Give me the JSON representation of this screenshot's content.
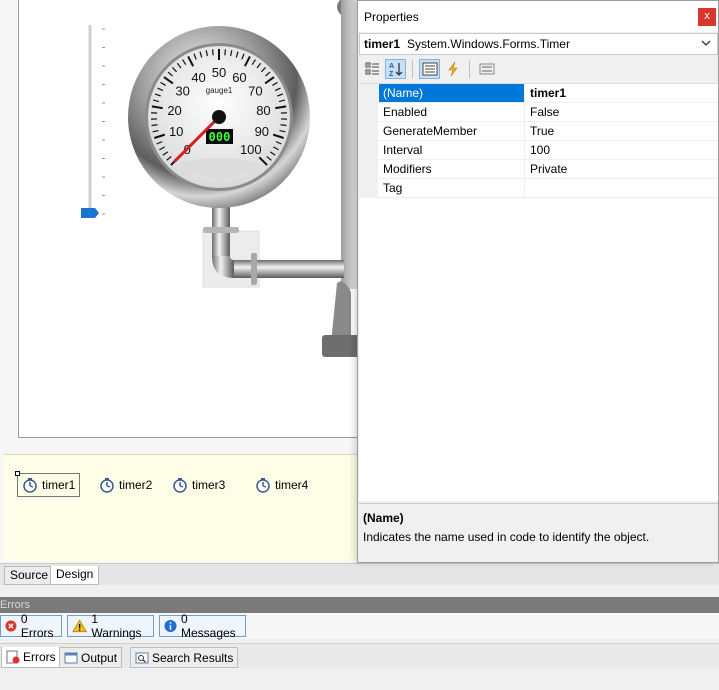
{
  "gauge": {
    "name_label": "gauge1",
    "scale_labels": [
      "0",
      "10",
      "20",
      "30",
      "40",
      "50",
      "60",
      "70",
      "80",
      "90",
      "100"
    ],
    "digital_readout": "000",
    "needle_value": 0
  },
  "slider": {
    "value_fraction": 0.0
  },
  "tray": {
    "items": [
      {
        "label": "timer1"
      },
      {
        "label": "timer2"
      },
      {
        "label": "timer3"
      },
      {
        "label": "timer4"
      }
    ]
  },
  "view_tabs": {
    "source": "Source",
    "design": "Design"
  },
  "errors_panel": {
    "header": "Errors",
    "errors_btn": "0 Errors",
    "warnings_btn": "1 Warnings",
    "messages_btn": "0 Messages"
  },
  "bottom_tabs": {
    "errors": "Errors",
    "output": "Output",
    "search": "Search Results"
  },
  "properties": {
    "title": "Properties",
    "close_label": "x",
    "object_name": "timer1",
    "object_type": "System.Windows.Forms.Timer",
    "rows": [
      {
        "name": "(Name)",
        "value": "timer1"
      },
      {
        "name": "Enabled",
        "value": "False"
      },
      {
        "name": "GenerateMember",
        "value": "True"
      },
      {
        "name": "Interval",
        "value": "100"
      },
      {
        "name": "Modifiers",
        "value": "Private"
      },
      {
        "name": "Tag",
        "value": ""
      }
    ],
    "description_title": "(Name)",
    "description_text": "Indicates the name used in code to identify the object."
  },
  "colors": {
    "accent": "#0078d7",
    "close_red": "#d9362e",
    "tray_bg": "#fefee8",
    "needle": "#d02020",
    "lcd_green": "#3dff3d"
  },
  "icons": [
    "timer-icon",
    "sort-categorized-icon",
    "sort-alphabetical-icon",
    "properties-icon",
    "events-icon",
    "property-pages-icon",
    "error-icon",
    "warning-icon",
    "info-icon",
    "output-icon",
    "search-results-icon",
    "dropdown-arrow-icon"
  ]
}
